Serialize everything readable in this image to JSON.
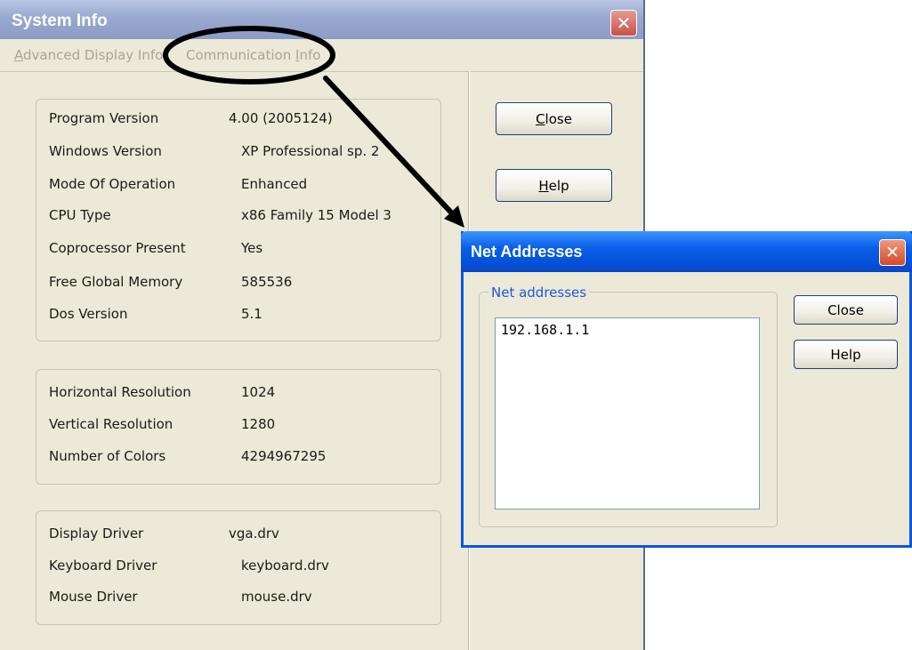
{
  "system_info": {
    "title": "System Info",
    "menu": [
      {
        "pre": "",
        "key": "A",
        "post": "dvanced Display Info"
      },
      {
        "pre": "Communication ",
        "key": "I",
        "post": "nfo"
      }
    ],
    "general": [
      {
        "label": "Program Version",
        "value": "4.00 (2005124)"
      },
      {
        "label": "Windows Version",
        "value": "XP Professional sp. 2"
      },
      {
        "label": "Mode Of Operation",
        "value": "Enhanced"
      },
      {
        "label": "CPU Type",
        "value": "x86 Family 15 Model 3"
      },
      {
        "label": "Coprocessor Present",
        "value": "Yes"
      },
      {
        "label": "Free Global Memory",
        "value": "585536"
      },
      {
        "label": "Dos Version",
        "value": "5.1"
      }
    ],
    "display": [
      {
        "label": "Horizontal Resolution",
        "value": "1024"
      },
      {
        "label": "Vertical Resolution",
        "value": "1280"
      },
      {
        "label": "Number of Colors",
        "value": "4294967295"
      }
    ],
    "drivers": [
      {
        "label": "Display Driver",
        "value": "vga.drv"
      },
      {
        "label": "Keyboard Driver",
        "value": "keyboard.drv"
      },
      {
        "label": "Mouse Driver",
        "value": "mouse.drv"
      }
    ],
    "close_button": {
      "key": "C",
      "rest": "lose"
    },
    "help_button": {
      "key": "H",
      "rest": "elp"
    }
  },
  "net_addresses": {
    "title": "Net Addresses",
    "group_label": "Net addresses",
    "addresses": [
      "192.168.1.1"
    ],
    "close_label": "Close",
    "help_label": "Help"
  },
  "colors": {
    "xp_blue_title": "#0450d8",
    "inactive_title": "#98a8cf",
    "dialog_bg": "#ece9d8",
    "annotation": "#000000"
  },
  "icons": {
    "close": "close-x-icon"
  }
}
